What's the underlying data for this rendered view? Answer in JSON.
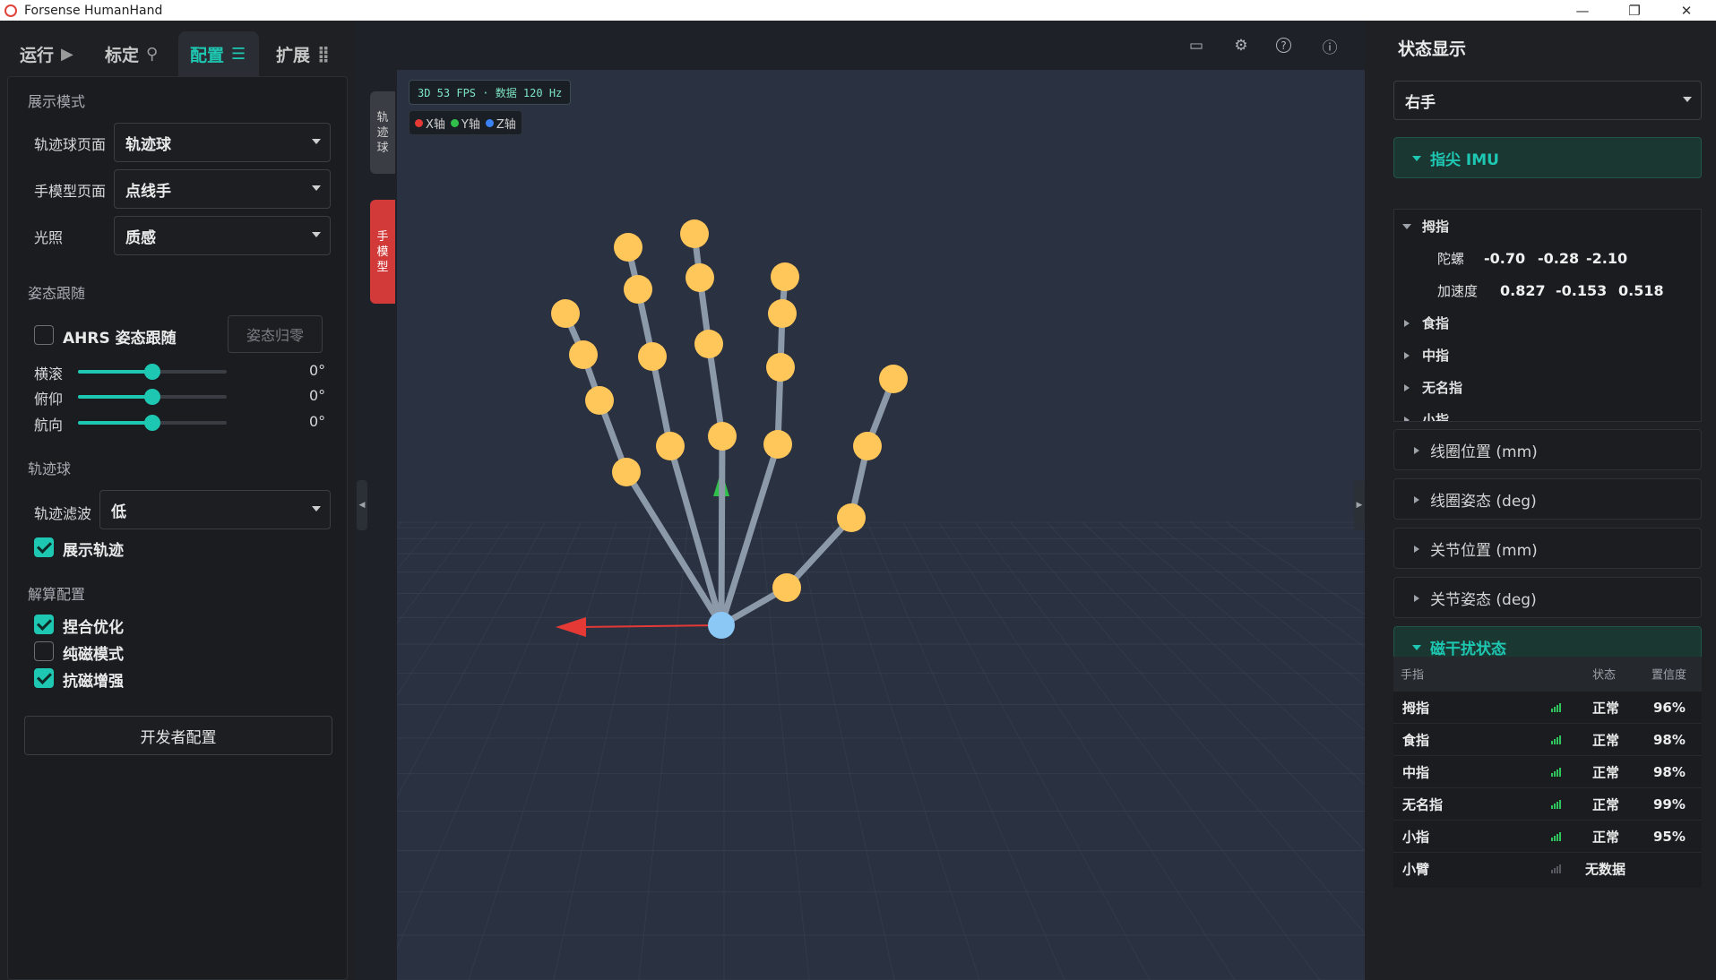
{
  "window": {
    "title": "Forsense HumanHand",
    "minimize": "—",
    "maximize": "❐",
    "close": "✕"
  },
  "tabs": [
    {
      "label": "运行",
      "icon": "play-circle-icon",
      "glyph": "▶"
    },
    {
      "label": "标定",
      "icon": "mic-icon",
      "glyph": "🎙"
    },
    {
      "label": "配置",
      "icon": "sliders-icon",
      "glyph": "☰",
      "active": true
    },
    {
      "label": "扩展",
      "icon": "grid-icon",
      "glyph": "⣿"
    }
  ],
  "display": {
    "section": "展示模式",
    "trackball_page": {
      "label": "轨迹球页面",
      "value": "轨迹球"
    },
    "hand_model_page": {
      "label": "手模型页面",
      "value": "点线手"
    },
    "lighting": {
      "label": "光照",
      "value": "质感"
    }
  },
  "pose": {
    "section": "姿态跟随",
    "ahrs": {
      "label": "AHRS 姿态跟随",
      "checked": false
    },
    "reset_button": "姿态归零",
    "sliders": [
      {
        "label": "横滚",
        "value": "0°",
        "level": 0.5
      },
      {
        "label": "俯仰",
        "value": "0°",
        "level": 0.5
      },
      {
        "label": "航向",
        "value": "0°",
        "level": 0.5
      }
    ]
  },
  "trackball": {
    "section": "轨迹球",
    "filter": {
      "label": "轨迹滤波",
      "value": "低"
    },
    "show_trace": {
      "label": "展示轨迹",
      "checked": true
    }
  },
  "solver": {
    "section": "解算配置",
    "options": [
      {
        "label": "捏合优化",
        "checked": true
      },
      {
        "label": "纯磁模式",
        "checked": false
      },
      {
        "label": "抗磁增强",
        "checked": true
      }
    ],
    "dev_button": "开发者配置"
  },
  "viewport": {
    "toolbar_icons": [
      "screen-record-icon",
      "gear-icon",
      "help-icon",
      "info-icon"
    ],
    "toolbar_glyphs": [
      "▭",
      "⚙",
      "?",
      "ⓘ"
    ],
    "side_tabs": [
      {
        "label": [
          "轨",
          "迹",
          "球"
        ],
        "active": false
      },
      {
        "label": [
          "手",
          "模",
          "型"
        ],
        "active": true
      }
    ],
    "fps_text": "3D 53 FPS · 数据 120 Hz",
    "axes_legend": [
      {
        "label": "X轴",
        "color": "#e53935"
      },
      {
        "label": "Y轴",
        "color": "#2fbf4a"
      },
      {
        "label": "Z轴",
        "color": "#3b82f6"
      }
    ],
    "colors": {
      "bone": "#8b99a8",
      "joint": "#ffc65a",
      "wrist": "#8cc8f5",
      "x_axis": "#e53935",
      "y_axis": "#2fbf4a",
      "grid": "#3a4456"
    }
  },
  "status": {
    "title": "状态显示",
    "hand_select": "右手",
    "imu": {
      "header": "指尖 IMU",
      "thumb": "拇指",
      "gyro_label": "陀螺",
      "gyro": [
        "-0.70",
        "-0.28",
        "-2.10"
      ],
      "acc_label": "加速度",
      "acc": [
        "0.827",
        "-0.153",
        "0.518"
      ],
      "fingers": [
        "食指",
        "中指",
        "无名指",
        "小指"
      ]
    },
    "sections": [
      "线圈位置 (mm)",
      "线圈姿态 (deg)",
      "关节位置 (mm)",
      "关节姿态 (deg)"
    ],
    "mag": {
      "header": "磁干扰状态",
      "columns": [
        "手指",
        "状态",
        "置信度"
      ],
      "rows": [
        {
          "finger": "拇指",
          "state": "正常",
          "confidence": "96%"
        },
        {
          "finger": "食指",
          "state": "正常",
          "confidence": "98%"
        },
        {
          "finger": "中指",
          "state": "正常",
          "confidence": "98%"
        },
        {
          "finger": "无名指",
          "state": "正常",
          "confidence": "99%"
        },
        {
          "finger": "小指",
          "state": "正常",
          "confidence": "95%"
        },
        {
          "finger": "小臂",
          "state": "无数据",
          "confidence": ""
        }
      ]
    }
  }
}
